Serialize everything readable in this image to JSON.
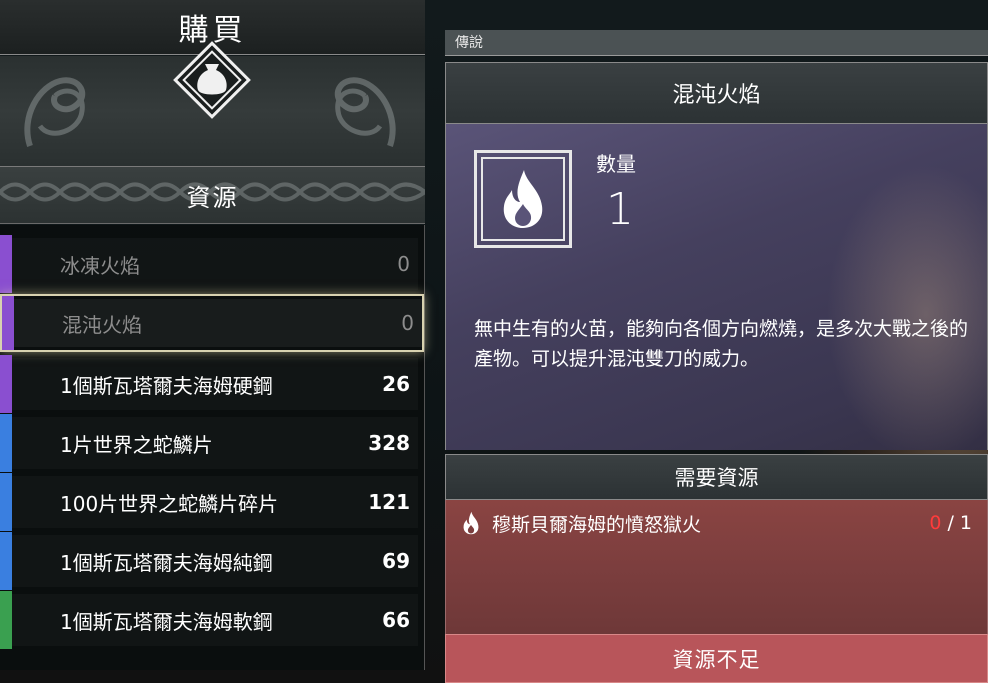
{
  "shop": {
    "title": "購買",
    "category": "資源",
    "emblem_icon": "pouch-icon"
  },
  "resource_list": [
    {
      "name": "冰凍火焰",
      "count": "0",
      "color": "#8a4fd0",
      "state": "dim"
    },
    {
      "name": "混沌火焰",
      "count": "0",
      "color": "#8a4fd0",
      "state": "selected"
    },
    {
      "name": "1個斯瓦塔爾夫海姆硬鋼",
      "count": "26",
      "color": "#8a4fd0",
      "state": "normal"
    },
    {
      "name": "1片世界之蛇鱗片",
      "count": "328",
      "color": "#3a7fe0",
      "state": "normal"
    },
    {
      "name": "100片世界之蛇鱗片碎片",
      "count": "121",
      "color": "#3a7fe0",
      "state": "normal"
    },
    {
      "name": "1個斯瓦塔爾夫海姆純鋼",
      "count": "69",
      "color": "#3a7fe0",
      "state": "normal"
    },
    {
      "name": "1個斯瓦塔爾夫海姆軟鋼",
      "count": "66",
      "color": "#3aa050",
      "state": "normal"
    }
  ],
  "detail": {
    "rarity_tag": "傳說",
    "item_name": "混沌火焰",
    "item_icon": "flame-icon",
    "quantity_label": "數量",
    "quantity_value": "1",
    "description": "無中生有的火苗，能夠向各個方向燃燒，是多次大戰之後的產物。可以提升混沌雙刀的威力。",
    "rarity_color": "#5a5478"
  },
  "requirements": {
    "header": "需要資源",
    "items": [
      {
        "icon": "flame-icon",
        "name": "穆斯貝爾海姆的憤怒獄火",
        "have": "0",
        "separator": " / ",
        "need": "1"
      }
    ],
    "insufficient_label": "資源不足",
    "warning_color": "#ff3b3b"
  }
}
